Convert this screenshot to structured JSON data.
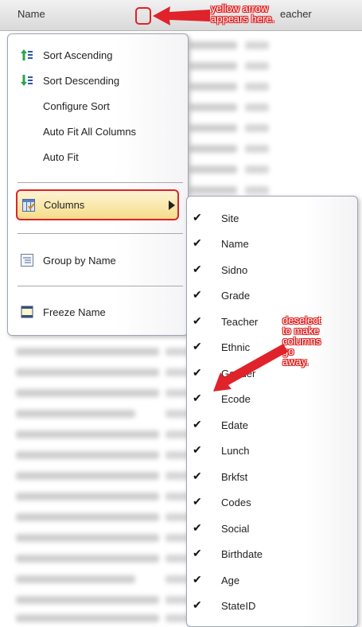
{
  "grid": {
    "header": {
      "name": "Name",
      "teacher": "eacher"
    }
  },
  "context_menu": {
    "items": [
      {
        "label": "Sort Ascending",
        "icon": "sort-ascending-icon"
      },
      {
        "label": "Sort Descending",
        "icon": "sort-descending-icon"
      },
      {
        "label": "Configure Sort"
      },
      {
        "label": "Auto Fit All Columns"
      },
      {
        "label": "Auto Fit"
      },
      {
        "label": "Columns",
        "icon": "columns-icon"
      },
      {
        "label": "Group by Name",
        "icon": "group-icon"
      },
      {
        "label": "Freeze Name",
        "icon": "freeze-icon"
      }
    ]
  },
  "columns_submenu": {
    "items": [
      {
        "label": "Site",
        "checked": true
      },
      {
        "label": "Name",
        "checked": true
      },
      {
        "label": "Sidno",
        "checked": true
      },
      {
        "label": "Grade",
        "checked": true
      },
      {
        "label": "Teacher",
        "checked": true
      },
      {
        "label": "Ethnic",
        "checked": true
      },
      {
        "label": "Gender",
        "checked": true
      },
      {
        "label": "Ecode",
        "checked": true
      },
      {
        "label": "Edate",
        "checked": true
      },
      {
        "label": "Lunch",
        "checked": true
      },
      {
        "label": "Brkfst",
        "checked": true
      },
      {
        "label": "Codes",
        "checked": true
      },
      {
        "label": "Social",
        "checked": true
      },
      {
        "label": "Birthdate",
        "checked": true
      },
      {
        "label": "Age",
        "checked": true
      },
      {
        "label": "StateID",
        "checked": true
      }
    ],
    "check_glyph": "✔"
  },
  "annotations": {
    "arrow_note": [
      "yellow arrow",
      "appears here."
    ],
    "deselect_note": [
      "deselect",
      "to make",
      "columns",
      "go",
      "away."
    ]
  },
  "colors": {
    "callout_red": "#e0222a",
    "highlight_yellow": "#f6dd8a"
  }
}
